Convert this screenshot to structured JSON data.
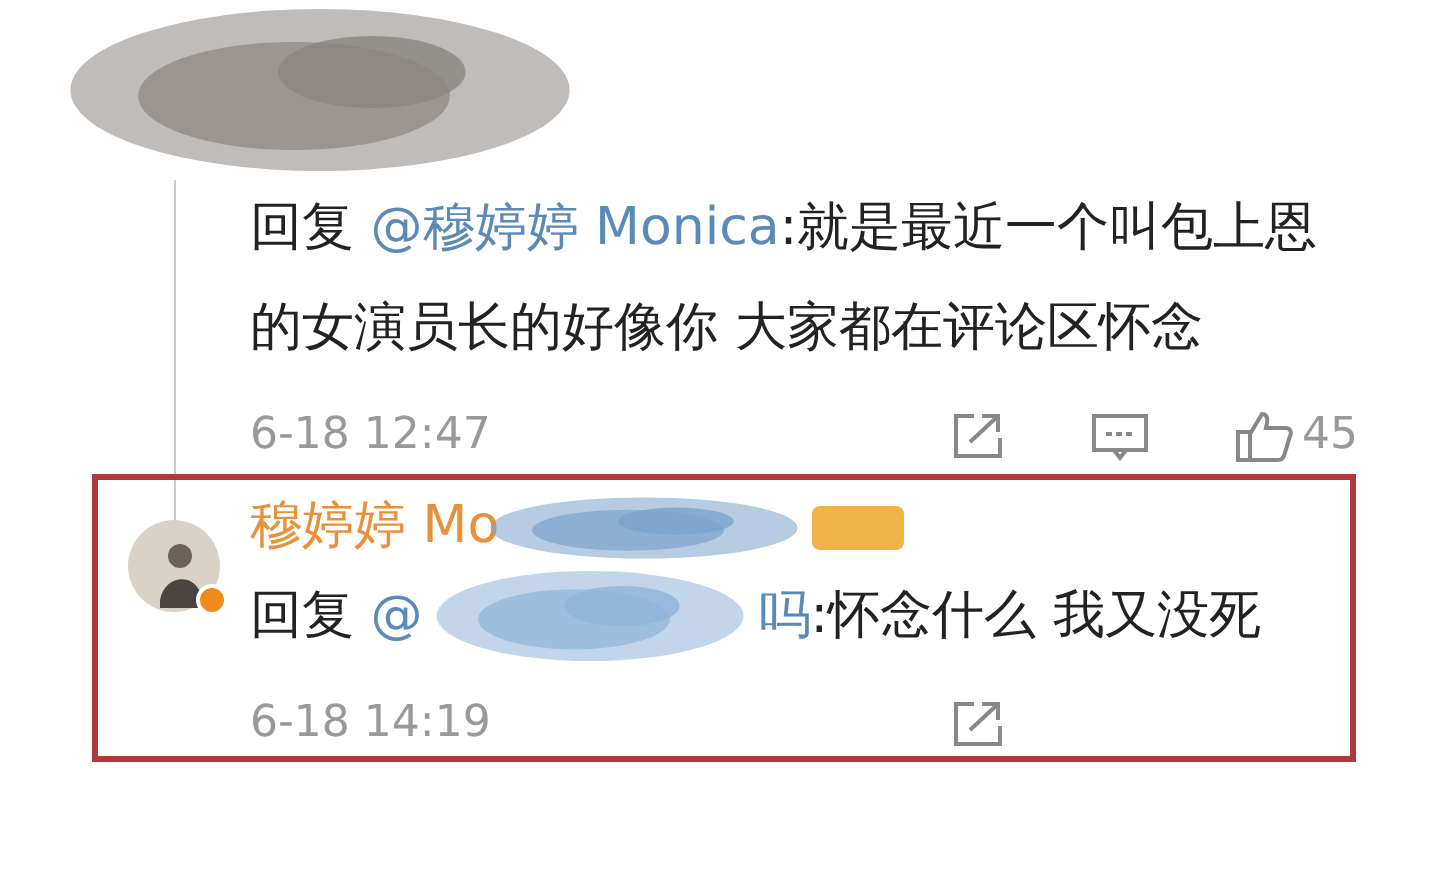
{
  "comments": [
    {
      "kind": "reply",
      "prefix": "回复",
      "mention": "@穆婷婷 Monica",
      "text": ":就是最近一个叫包上恩的女演员长的好像你  大家都在评论区怀念",
      "time": "6-18 12:47",
      "likes": "45",
      "highlighted": false
    },
    {
      "kind": "author",
      "name": "穆婷婷 Mo",
      "verified": true,
      "prefix": "回复",
      "mention_start": "@",
      "mention_end": "吗",
      "text": ":怀念什么 我又没死",
      "time": "6-18 14:19",
      "highlighted": true
    }
  ]
}
